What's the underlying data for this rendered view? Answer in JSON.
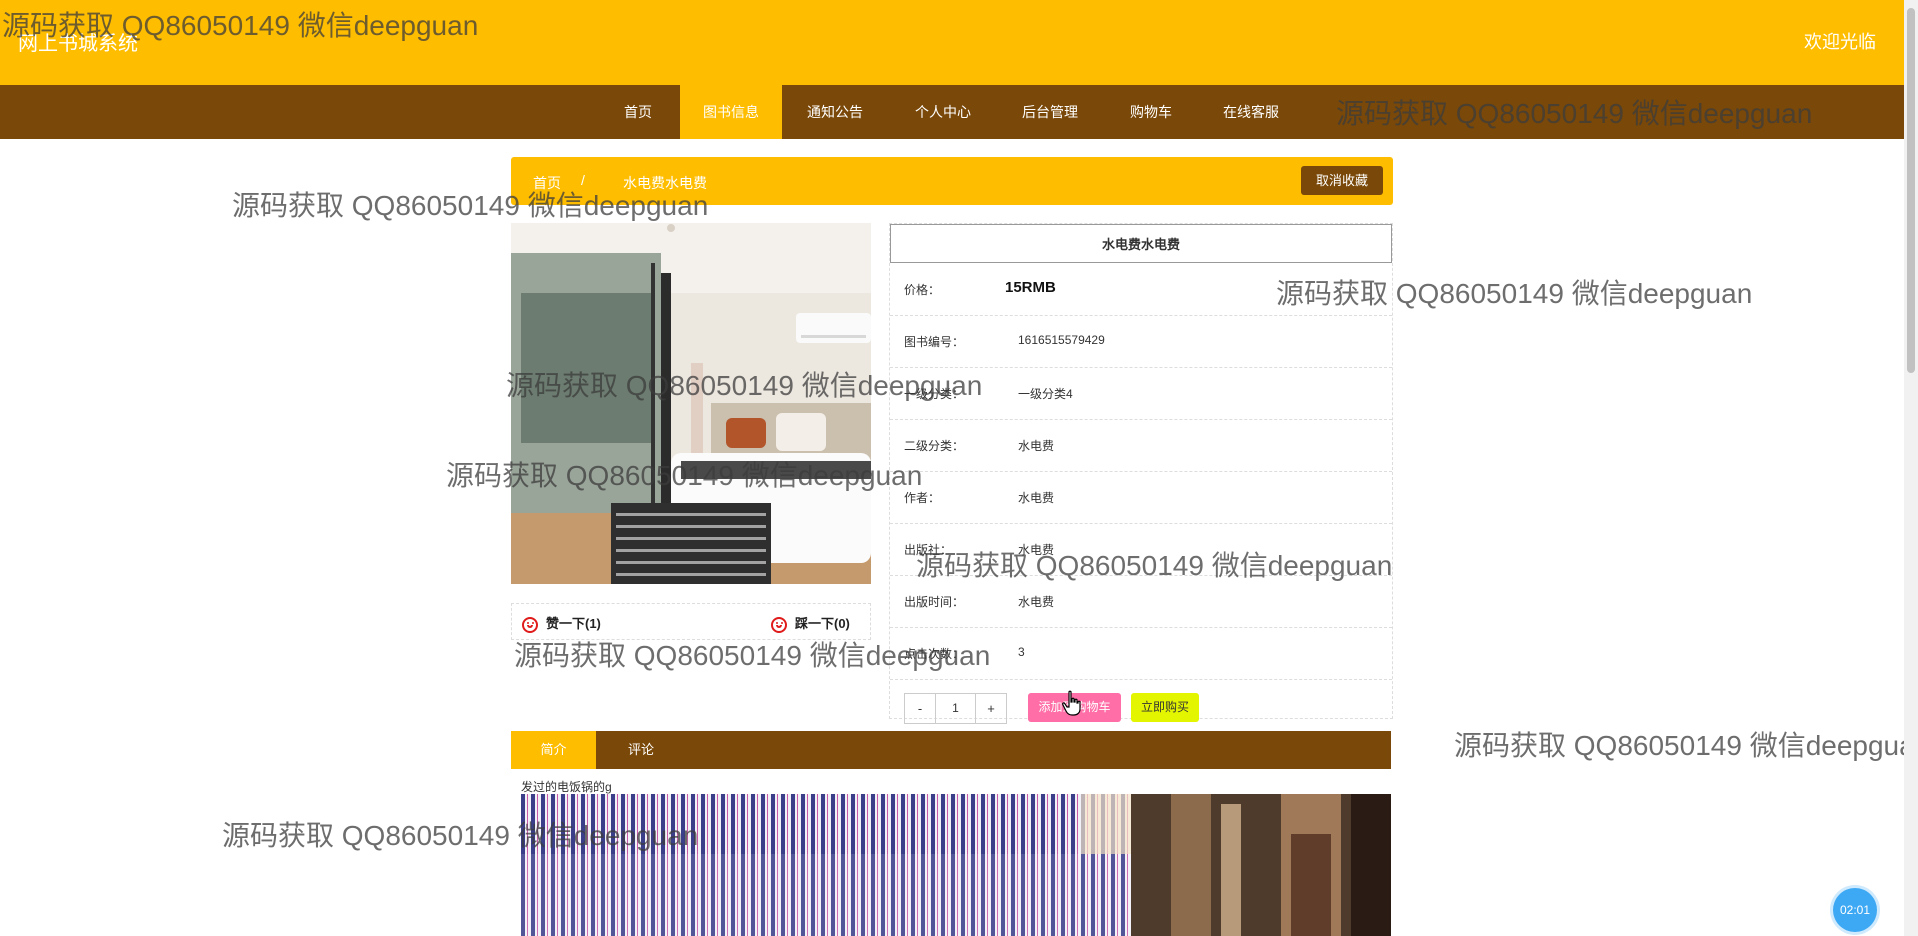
{
  "header": {
    "site_title": "网上书城系统",
    "welcome": "欢迎光临"
  },
  "nav": {
    "items": [
      {
        "label": "首页"
      },
      {
        "label": "图书信息",
        "active": true
      },
      {
        "label": "通知公告"
      },
      {
        "label": "个人中心"
      },
      {
        "label": "后台管理"
      },
      {
        "label": "购物车"
      },
      {
        "label": "在线客服"
      }
    ]
  },
  "breadcrumb": {
    "home": "首页",
    "current": "水电费水电费",
    "cancel_favorite": "取消收藏"
  },
  "product": {
    "title": "水电费水电费",
    "price_label": "价格：",
    "price_value": "15RMB",
    "fields": [
      {
        "label": "图书编号：",
        "value": "1616515579429"
      },
      {
        "label": "一级分类：",
        "value": "一级分类4"
      },
      {
        "label": "二级分类：",
        "value": "水电费"
      },
      {
        "label": "作者：",
        "value": "水电费"
      },
      {
        "label": "出版社：",
        "value": "水电费"
      },
      {
        "label": "出版时间：",
        "value": "水电费"
      },
      {
        "label": "点击次数：",
        "value": "3"
      }
    ],
    "quantity": "1",
    "minus": "-",
    "plus": "+",
    "add_to_cart": "添加到购物车",
    "buy_now": "立即购买"
  },
  "votes": {
    "like": "赞一下(1)",
    "dislike": "踩一下(0)"
  },
  "tabs": [
    {
      "label": "简介",
      "active": true
    },
    {
      "label": "评论"
    }
  ],
  "description": {
    "text": "发过的电饭锅的g"
  },
  "timer": "02:01",
  "watermark": "源码获取 QQ86050149 微信deepguan",
  "colors": {
    "accent": "#ffbd00",
    "brown": "#7a4808",
    "pink": "#ff6ea7",
    "lime": "#e4f500"
  }
}
